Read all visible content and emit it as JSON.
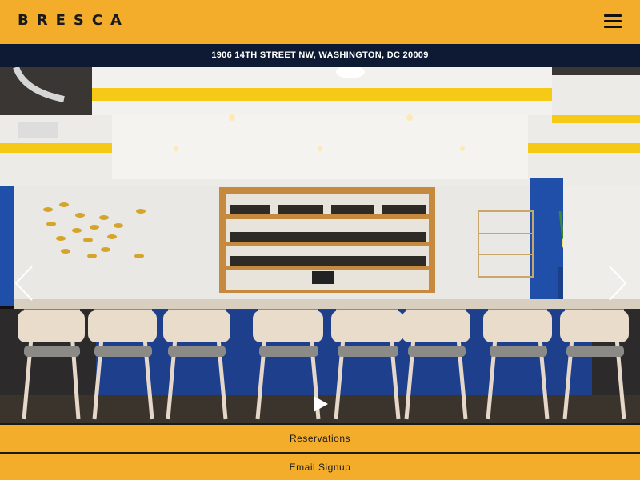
{
  "header": {
    "logo_text": "BRESCA",
    "menu_icon": "hamburger-menu-icon"
  },
  "address": {
    "text": "1906 14TH STREET NW, WASHINGTON, DC 20009"
  },
  "hero": {
    "prev_icon": "chevron-left-icon",
    "next_icon": "chevron-right-icon",
    "play_icon": "play-icon"
  },
  "cta": {
    "reservations_label": "Reservations",
    "email_signup_label": "Email Signup"
  },
  "colors": {
    "brand_yellow": "#f3ad2a",
    "navy": "#0e1a33",
    "accent_blue": "#1f4fa8"
  }
}
